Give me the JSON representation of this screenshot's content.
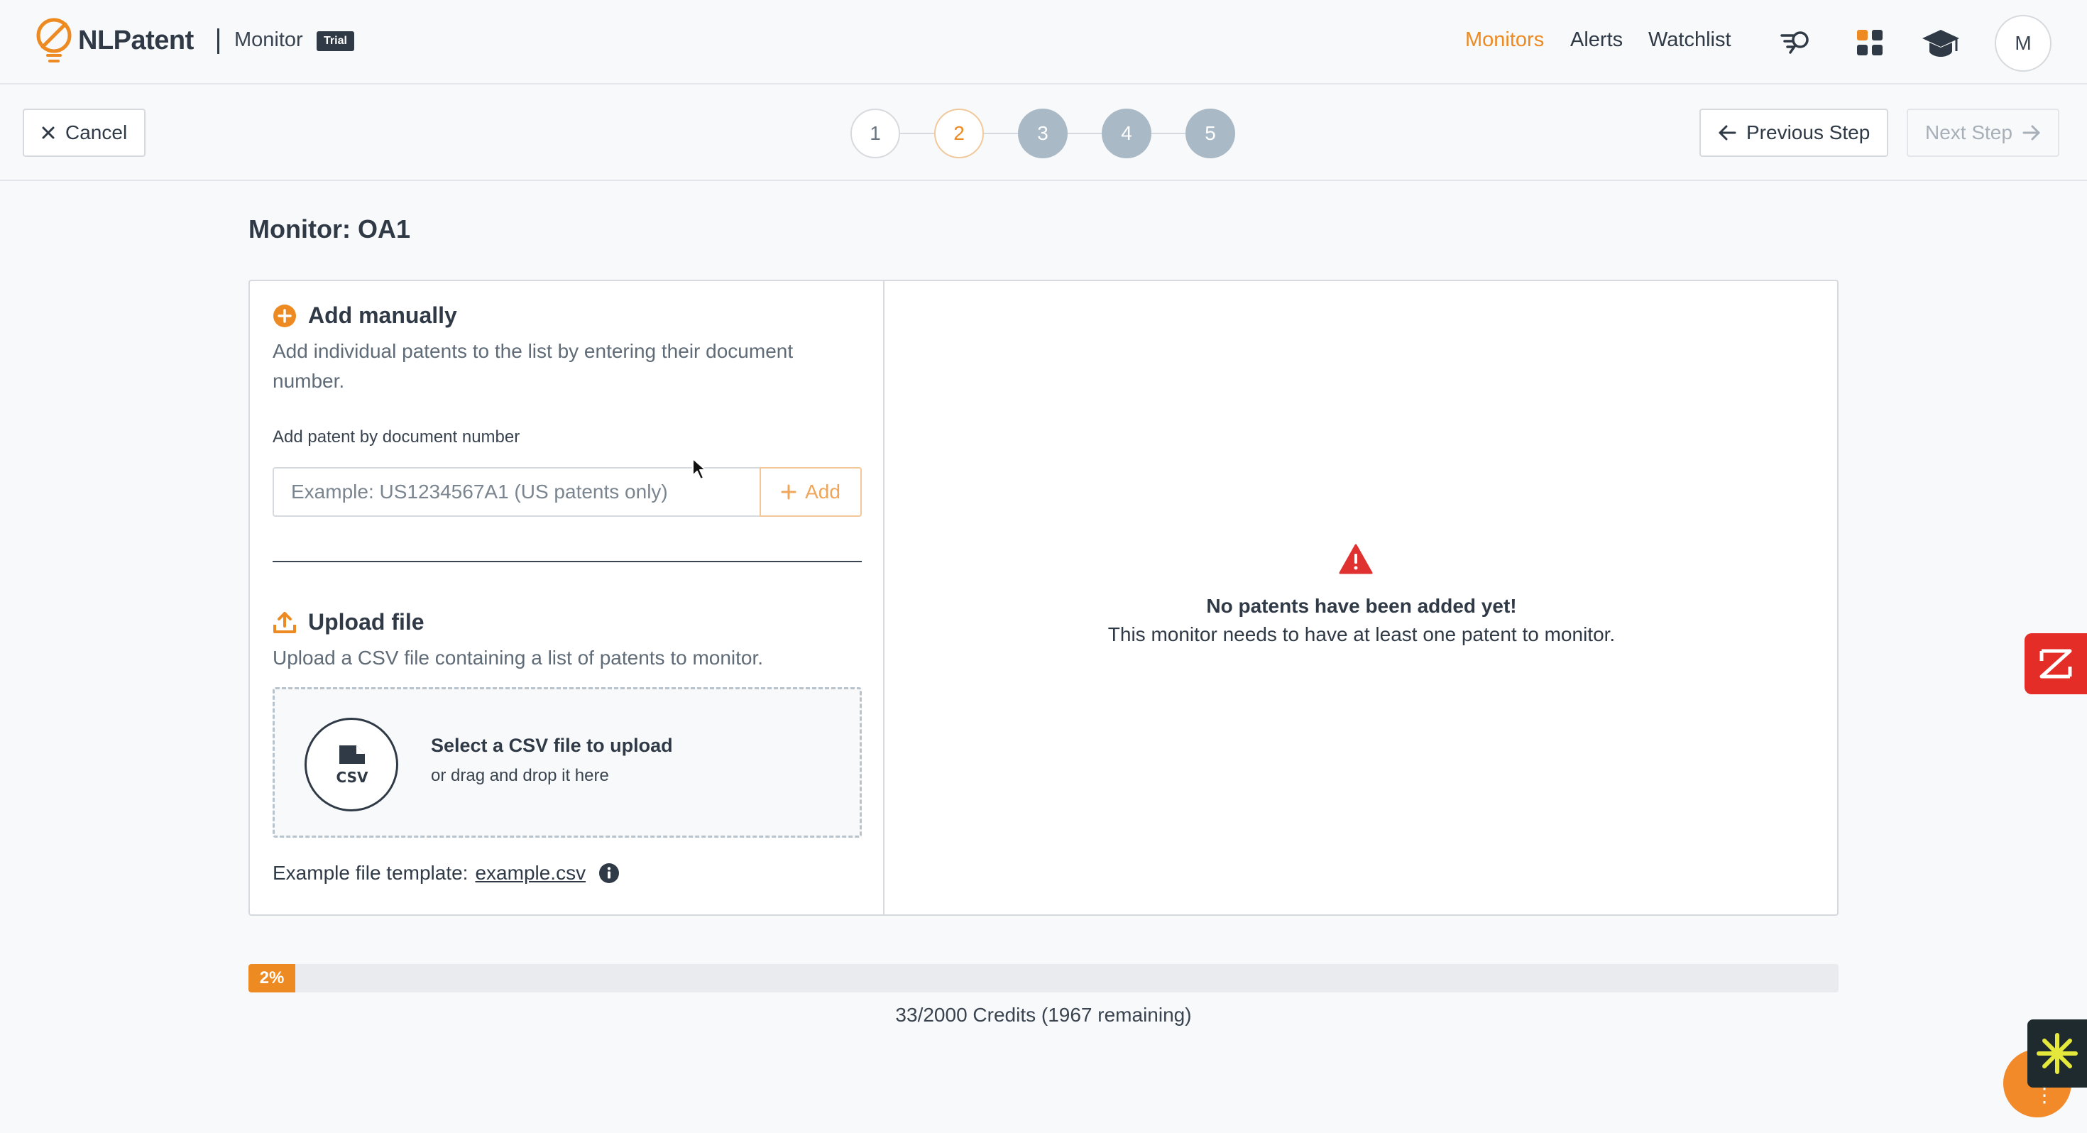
{
  "header": {
    "brand": "NLPatent",
    "product": "Monitor",
    "badge": "Trial",
    "nav": [
      {
        "label": "Monitors",
        "active": true
      },
      {
        "label": "Alerts",
        "active": false
      },
      {
        "label": "Watchlist",
        "active": false
      }
    ],
    "icons": [
      "search-list-icon",
      "apps-grid-icon",
      "graduation-cap-icon"
    ],
    "avatar_initial": "M"
  },
  "wizard": {
    "cancel_label": "Cancel",
    "prev_label": "Previous Step",
    "next_label": "Next Step",
    "steps": [
      {
        "label": "1",
        "state": "done"
      },
      {
        "label": "2",
        "state": "current"
      },
      {
        "label": "3",
        "state": "todo"
      },
      {
        "label": "4",
        "state": "todo"
      },
      {
        "label": "5",
        "state": "todo"
      }
    ]
  },
  "page": {
    "title_prefix": "Monitor:",
    "title_name": "OA1"
  },
  "add_manually": {
    "title": "Add manually",
    "description": "Add individual patents to the list by entering their document number.",
    "field_label": "Add patent by document number",
    "input_placeholder": "Example: US1234567A1 (US patents only)",
    "add_label": "Add"
  },
  "upload": {
    "title": "Upload file",
    "description": "Upload a CSV file containing a list of patents to monitor.",
    "dropzone_title": "Select a CSV file to upload",
    "dropzone_subtitle": "or drag and drop it here",
    "csv_glyph": "CSV",
    "template_label": "Example file template:",
    "template_link": "example.csv"
  },
  "empty_state": {
    "title": "No patents have been added yet!",
    "description": "This monitor needs to have at least one patent to monitor."
  },
  "credits": {
    "percent_label": "2%",
    "used_fraction": 0.0165,
    "text": "33/2000 Credits (1967 remaining)"
  },
  "colors": {
    "accent": "#ee8a22",
    "danger": "#e03131",
    "text": "#2f3a46",
    "step_todo": "#a9b9c6"
  }
}
